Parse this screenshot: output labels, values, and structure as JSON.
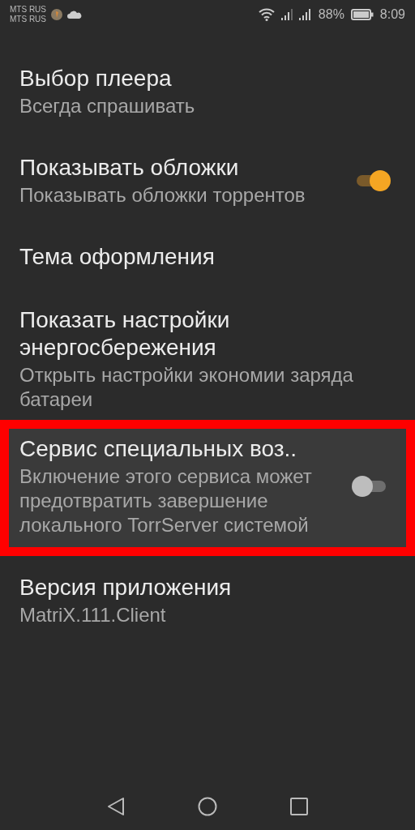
{
  "status_bar": {
    "carriers": [
      "MTS RUS",
      "MTS RUS"
    ],
    "battery_percent": "88%",
    "time": "8:09"
  },
  "settings": [
    {
      "kind": "plain",
      "title": "Выбор плеера",
      "summary": "Всегда спрашивать",
      "highlighted": false
    },
    {
      "kind": "switch",
      "title": "Показывать обложки",
      "summary": "Показывать обложки торрентов",
      "on": true,
      "highlighted": false
    },
    {
      "kind": "plain",
      "title": "Тема оформления",
      "highlighted": false
    },
    {
      "kind": "plain",
      "title": "Показать настройки энергосбережения",
      "summary": "Открыть настройки экономии заряда батареи",
      "highlighted": false
    },
    {
      "kind": "switch",
      "title": "Сервис специальных воз..",
      "summary": "Включение этого сервиса может предотвратить завершение локального TorrServer системой",
      "on": false,
      "highlighted": true
    },
    {
      "kind": "plain",
      "title": "Версия приложения",
      "summary": "MatriX.111.Client",
      "highlighted": false
    }
  ]
}
